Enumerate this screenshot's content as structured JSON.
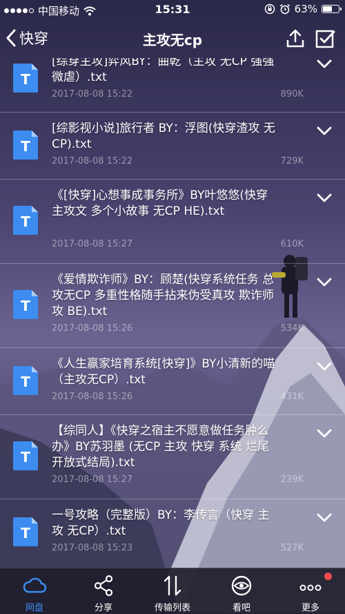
{
  "status_bar": {
    "carrier": "中国移动",
    "time": "15:31",
    "battery": "63%",
    "battery_level": 0.63,
    "signal_bars": 4,
    "icons": [
      "wifi-icon",
      "rotation-lock-icon",
      "alarm-icon",
      "battery-icon"
    ]
  },
  "nav": {
    "back_label": "快穿",
    "title": "主攻无cp",
    "icons": [
      "back-chevron-icon",
      "upload-icon",
      "select-checkbox-icon"
    ]
  },
  "files": [
    {
      "name": "[综穿主攻]弈风BY：曲乾（主攻 无CP 强强 微虐）.txt",
      "date": "2017-08-08 15:22",
      "size": "890K"
    },
    {
      "name": "[综影视小说]旅行者 BY：浮图(快穿渣攻 无CP).txt",
      "date": "2017-08-08 15:22",
      "size": "729K"
    },
    {
      "name": "《[快穿]心想事成事务所》BY叶悠悠(快穿 主攻文 多个小故事 无CP HE).txt",
      "date": "2017-08-08 15:27",
      "size": "610K"
    },
    {
      "name": "《爱情欺诈师》BY：顾楚(快穿系统任务 总攻无CP 多重性格随手拈来伪受真攻 欺诈师攻 BE).txt",
      "date": "2017-08-08 15:26",
      "size": "534K"
    },
    {
      "name": "《人生赢家培育系统[快穿]》BY小清新的喵 （主攻无CP）.txt",
      "date": "2017-08-08 15:26",
      "size": "431K"
    },
    {
      "name": "【综同人】《快穿之宿主不愿意做任务肿么办》BY苏羽墨 (无CP 主攻 快穿 系统 烂尾 开放式结局).txt",
      "date": "2017-08-08 15:27",
      "size": "239K"
    },
    {
      "name": "一号攻略（完整版）BY：李传言（快穿 主攻 无CP）.txt",
      "date": "2017-08-08 15:23",
      "size": "527K"
    }
  ],
  "file_icon_letter": "T",
  "file_icon_color": "#3d8cf0",
  "tabs": [
    {
      "label": "网盘",
      "icon": "cloud-icon",
      "active": true
    },
    {
      "label": "分享",
      "icon": "share-icon",
      "active": false
    },
    {
      "label": "传输列表",
      "icon": "transfer-icon",
      "active": false
    },
    {
      "label": "看吧",
      "icon": "eye-icon",
      "active": false
    },
    {
      "label": "更多",
      "icon": "more-icon",
      "active": false,
      "badge": true
    }
  ],
  "colors": {
    "accent": "#3d8cf0",
    "badge": "#f24b4b"
  }
}
